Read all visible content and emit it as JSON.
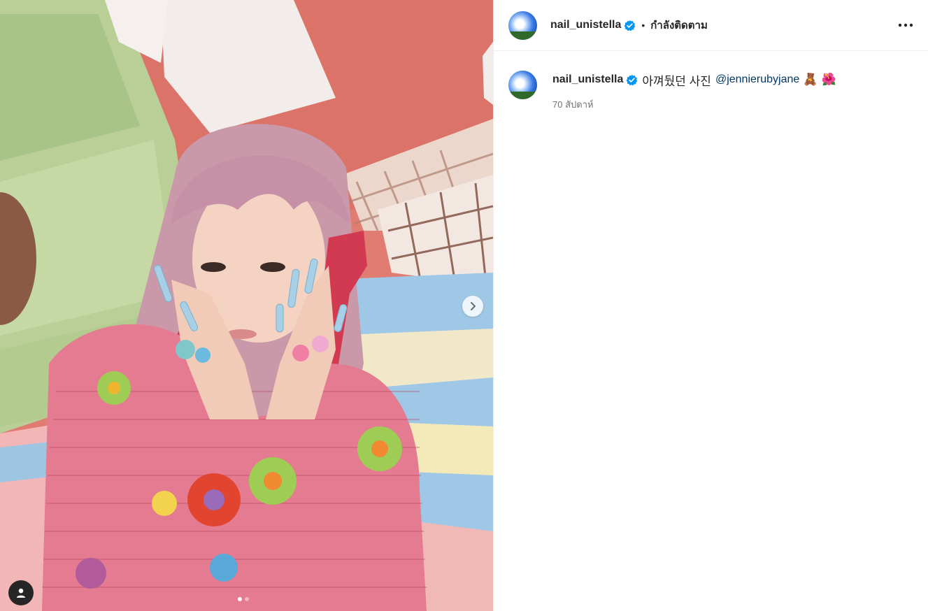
{
  "post": {
    "username": "nail_unistella",
    "follow_status": "กำลังติดตาม",
    "separator": "•",
    "verified_icon": "verified-badge-icon",
    "accent_color": "#0095f6"
  },
  "caption": {
    "username": "nail_unistella",
    "text": "아껴뒀던 사진",
    "mention": "@jennierubyjane",
    "emoji_1": "🧸",
    "emoji_2": "🌺",
    "timestamp": "70 สัปดาห์"
  },
  "media": {
    "slide_count": 2,
    "active_slide": 1,
    "next_icon": "chevron-right-icon",
    "tag_icon": "user-tag-icon"
  },
  "colors": {
    "link": "#00376b",
    "muted": "#737373",
    "divider": "#efefef"
  }
}
